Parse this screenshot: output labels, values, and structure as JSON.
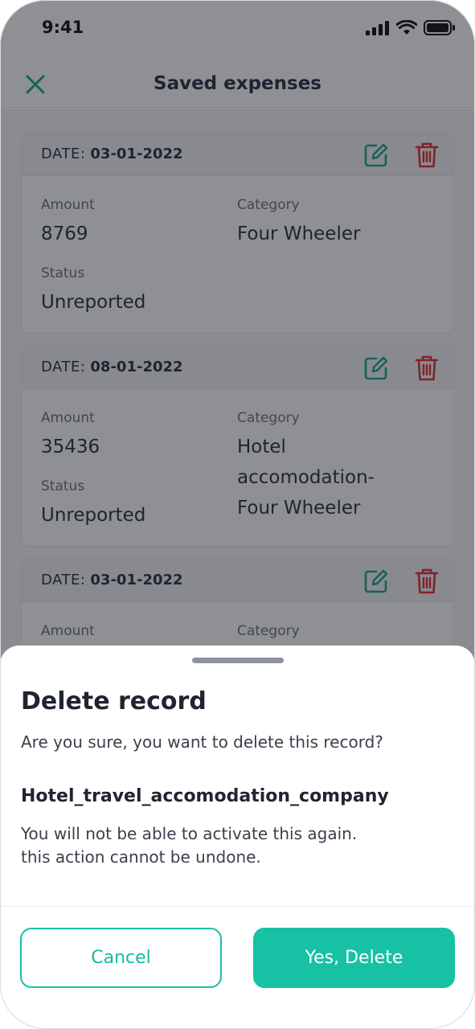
{
  "status_bar": {
    "time": "9:41",
    "icons": [
      "signal-icon",
      "wifi-icon",
      "battery-icon"
    ]
  },
  "header": {
    "title": "Saved expenses",
    "close_icon": "close-icon"
  },
  "cards": [
    {
      "date_label": "DATE:",
      "date": "03-01-2022",
      "amount_label": "Amount",
      "amount": "8769",
      "category_label": "Category",
      "category": "Four Wheeler",
      "status_label": "Status",
      "status": "Unreported"
    },
    {
      "date_label": "DATE:",
      "date": "08-01-2022",
      "amount_label": "Amount",
      "amount": "35436",
      "category_label": "Category",
      "category_lines": [
        "Hotel",
        "accomodation-",
        "Four Wheeler"
      ],
      "status_label": "Status",
      "status": "Unreported"
    },
    {
      "date_label": "DATE:",
      "date": "03-01-2022",
      "amount_label": "Amount",
      "category_label": "Category"
    }
  ],
  "sheet": {
    "title": "Delete record",
    "question": "Are you sure, you want to delete this record?",
    "record_name": "Hotel_travel_accomodation_company",
    "warning_line1": "You will not be able to activate this again.",
    "warning_line2": "this action cannot be undone.",
    "cancel_label": "Cancel",
    "confirm_label": "Yes, Delete"
  },
  "colors": {
    "accent": "#17c1a4",
    "delete_icon": "#e0312f",
    "edit_icon": "#16a98c",
    "overlay": "rgba(20,24,32,0.48)"
  }
}
